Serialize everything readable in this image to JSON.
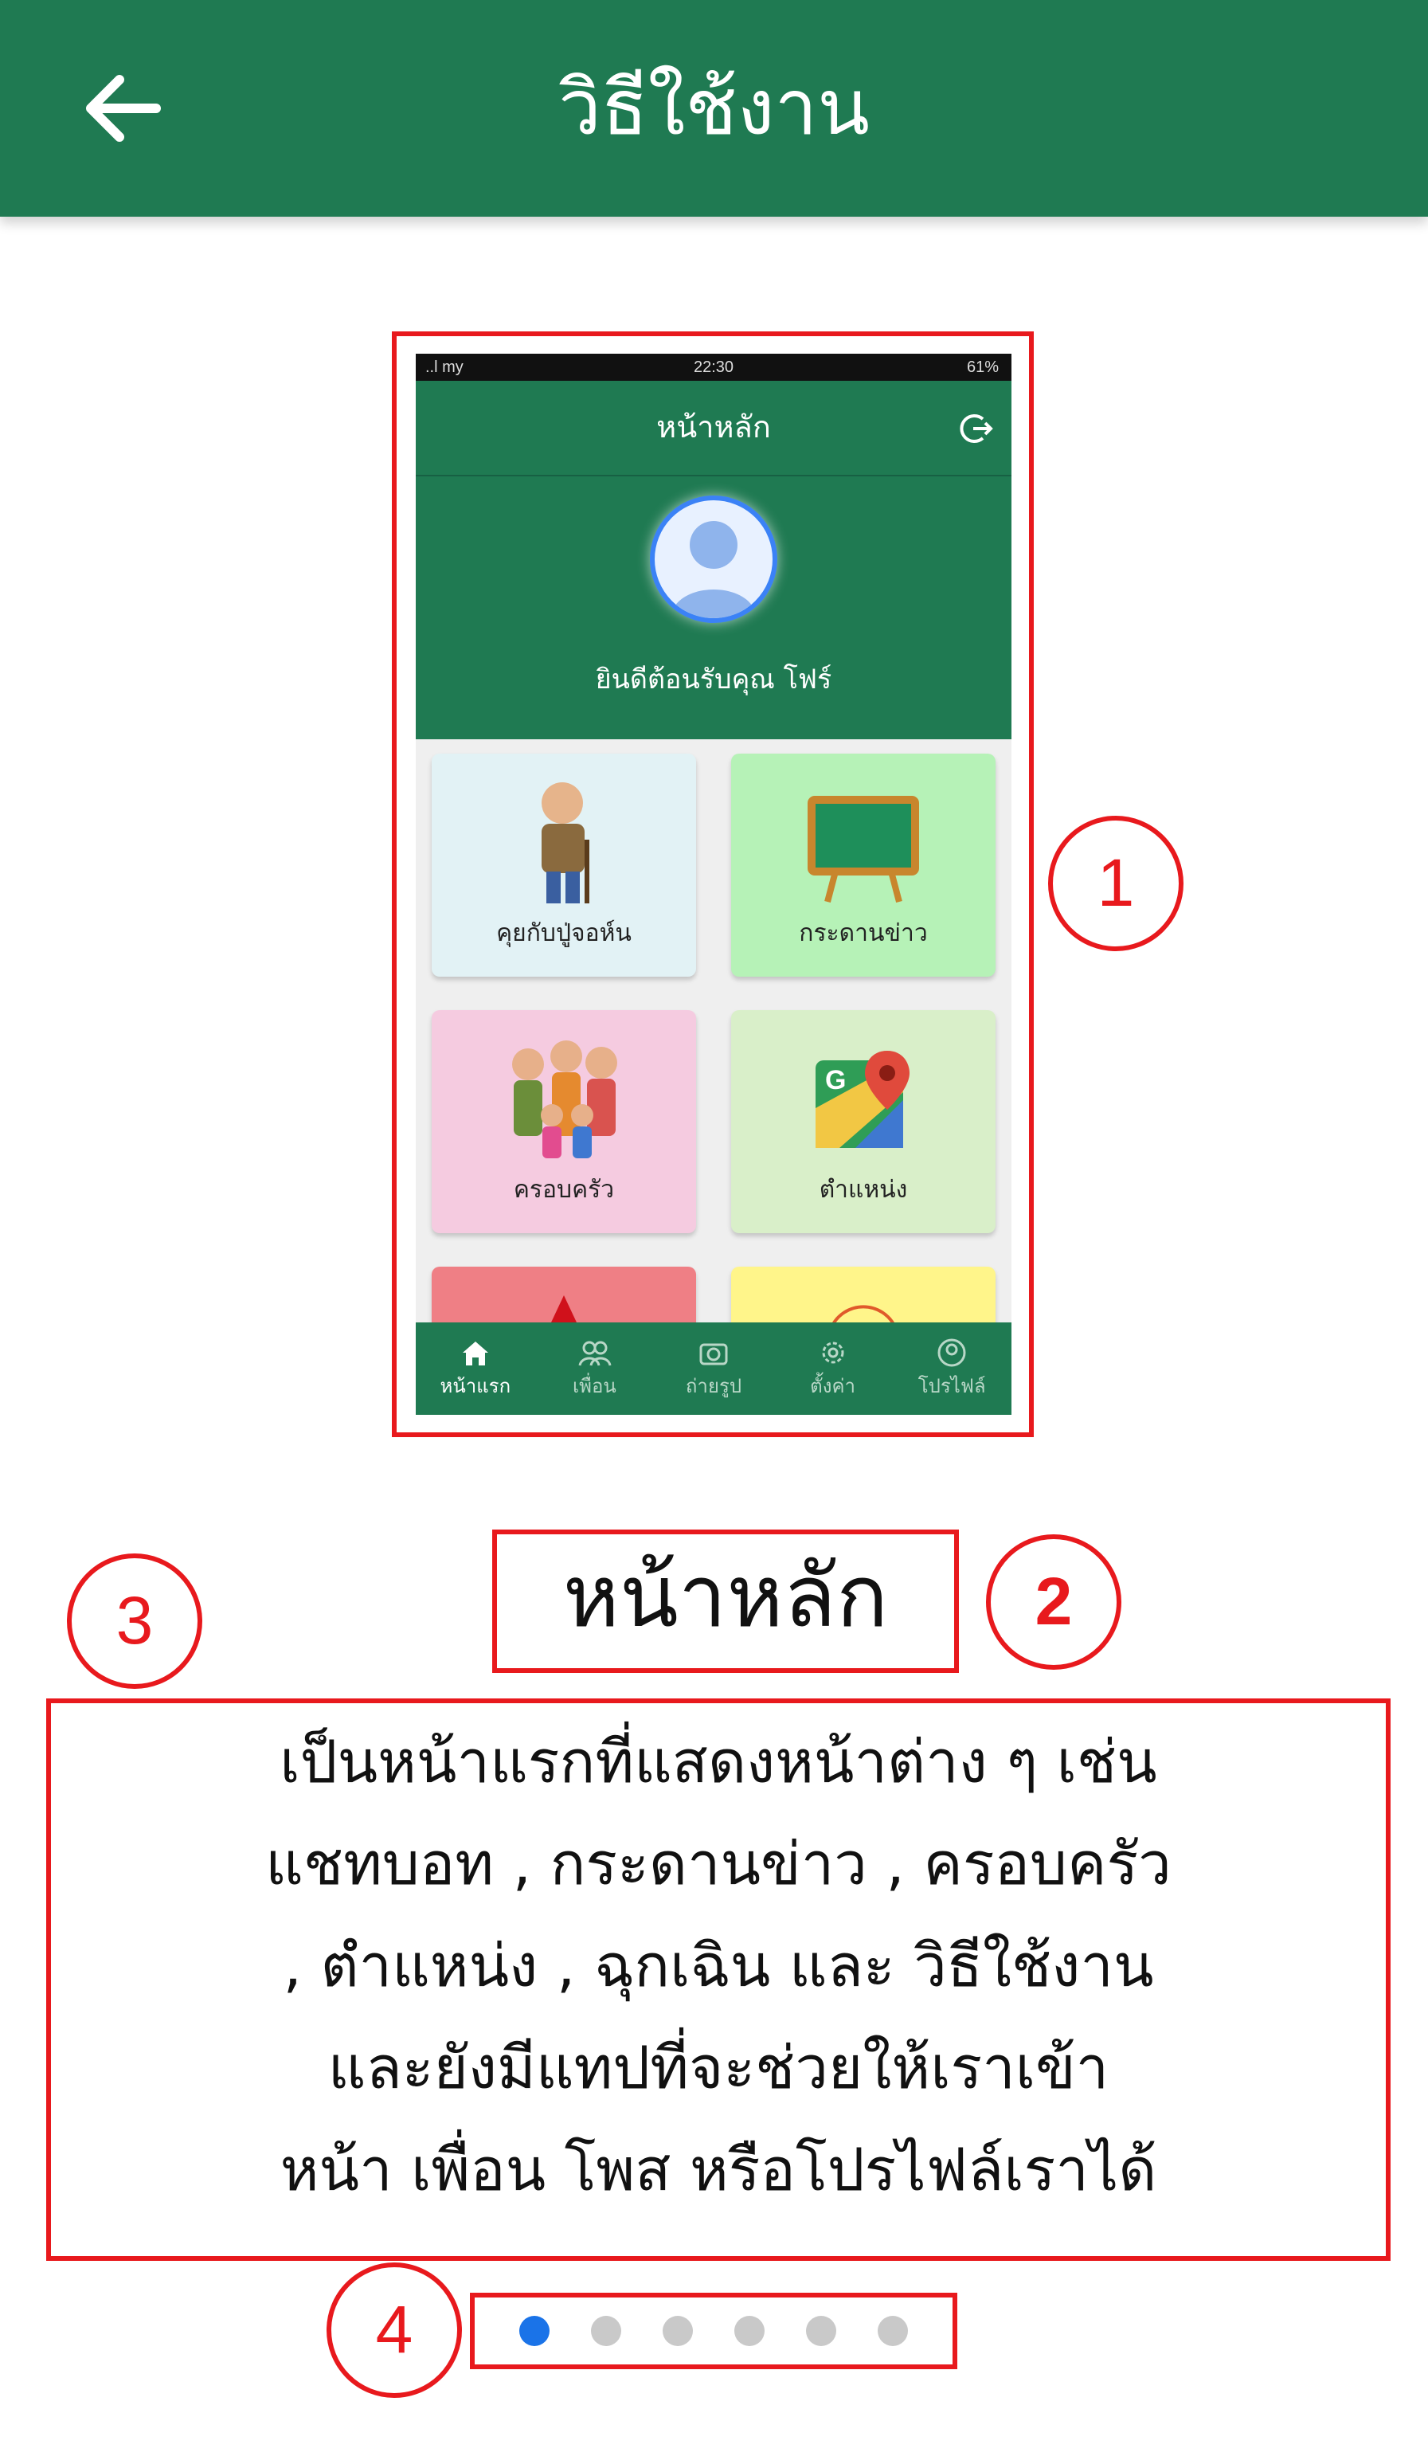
{
  "appbar": {
    "title": "วิธีใช้งาน",
    "back_icon": "arrow-left-icon"
  },
  "phone": {
    "status": {
      "carrier": "..l my",
      "time": "22:30",
      "battery": "61%"
    },
    "header_title": "หน้าหลัก",
    "welcome": "ยินดีต้อนรับคุณ โฟร์",
    "tiles": [
      {
        "label": "คุยกับปู่จอห์น",
        "color": "#e2f2f5"
      },
      {
        "label": "กระดานข่าว",
        "color": "#b6f2b7"
      },
      {
        "label": "ครอบครัว",
        "color": "#f5cbe0"
      },
      {
        "label": "ตำแหน่ง",
        "color": "#d9efc9"
      }
    ],
    "nav": [
      {
        "label": "หน้าแรก",
        "icon": "home-icon"
      },
      {
        "label": "เพื่อน",
        "icon": "friends-icon"
      },
      {
        "label": "ถ่ายรูป",
        "icon": "camera-icon"
      },
      {
        "label": "ตั้งค่า",
        "icon": "gear-icon"
      },
      {
        "label": "โปรไฟล์",
        "icon": "profile-icon"
      }
    ]
  },
  "callouts": {
    "c1": "1",
    "c2": "2",
    "c3": "3",
    "c4": "4"
  },
  "section_title": "หน้าหลัก",
  "description_lines": [
    "เป็นหน้าแรกที่แสดงหน้าต่าง ๆ เช่น",
    "แชทบอท , กระดานข่าว , ครอบครัว",
    ", ตำแหน่ง , ฉุกเฉิน และ วิธีใช้งาน",
    "และยังมีแทปที่จะช่วยให้เราเข้า",
    "หน้า เพื่อน โพส หรือโปรไฟล์เราได้"
  ],
  "pager": {
    "count": 6,
    "active_index": 0
  },
  "colors": {
    "primary": "#1f7a52",
    "annotation": "#e8191d",
    "dot_active": "#1a73e8",
    "dot_inactive": "#c9c9c9"
  }
}
